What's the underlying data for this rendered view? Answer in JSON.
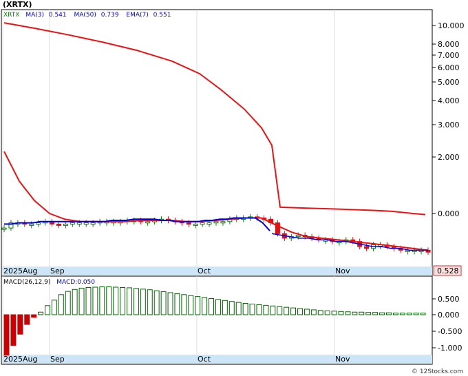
{
  "title": "(XRTX)",
  "legend": {
    "symbol": "XRTX",
    "ma3_label": "MA(3)",
    "ma3_value": "0.541",
    "ma50_label": "MA(50)",
    "ma50_value": "0.739",
    "ema7_label": "EMA(7)",
    "ema7_value": "0.551"
  },
  "macd_legend": {
    "params": "MACD(26,12,9)",
    "value_label": "MACD:0.050"
  },
  "price_badge": "0.528",
  "watermark": "© 12Stocks.com",
  "colors": {
    "ma3": "#0000dd",
    "ma50": "#ee1111",
    "up": "#008800",
    "down": "#dd1111",
    "hist_pos": "#006600",
    "hist_neg": "#cc0000",
    "axis_band": "#cce6f7"
  },
  "chart_data": [
    {
      "type": "line",
      "name": "price",
      "y_scale": "log",
      "y_ticks": [
        "10.000",
        "8.000",
        "7.000",
        "6.000",
        "5.000",
        "4.000",
        "3.000",
        "2.000",
        "0.000"
      ],
      "x_ticks": [
        "2025Aug",
        "Sep",
        "Oct",
        "Nov"
      ],
      "candles_close": [
        0.5,
        0.54,
        0.54,
        0.53,
        0.53,
        0.54,
        0.55,
        0.53,
        0.52,
        0.53,
        0.54,
        0.54,
        0.54,
        0.54,
        0.55,
        0.55,
        0.55,
        0.55,
        0.56,
        0.56,
        0.55,
        0.55,
        0.56,
        0.57,
        0.56,
        0.55,
        0.54,
        0.53,
        0.53,
        0.54,
        0.54,
        0.55,
        0.55,
        0.57,
        0.58,
        0.58,
        0.59,
        0.58,
        0.57,
        0.54,
        0.46,
        0.43,
        0.44,
        0.45,
        0.44,
        0.43,
        0.42,
        0.42,
        0.41,
        0.41,
        0.42,
        0.41,
        0.38,
        0.37,
        0.39,
        0.39,
        0.38,
        0.37,
        0.36,
        0.36,
        0.36,
        0.36,
        0.35
      ],
      "series": [
        {
          "name": "MA(3)",
          "values": [
            0.53,
            0.53,
            0.54,
            0.54,
            0.54,
            0.55,
            0.55,
            0.55,
            0.55,
            0.55,
            0.55,
            0.55,
            0.55,
            0.55,
            0.55,
            0.56,
            0.56,
            0.56,
            0.57,
            0.57,
            0.57,
            0.57,
            0.56,
            0.56,
            0.55,
            0.55,
            0.55,
            0.55,
            0.56,
            0.56,
            0.57,
            0.57,
            0.58,
            0.58,
            0.58,
            0.58,
            0.54,
            0.48,
            0.46,
            0.45,
            0.44,
            0.43,
            0.43,
            0.42,
            0.42,
            0.41,
            0.41,
            0.4,
            0.39,
            0.38,
            0.38,
            0.37,
            0.37,
            0.36,
            0.36,
            0.36
          ]
        },
        {
          "name": "MA(50)",
          "values": [
            10.4,
            9.6,
            8.7,
            7.8,
            6.9,
            5.9,
            4.9,
            3.9,
            2.9,
            2.2,
            1.7,
            0.68,
            0.67,
            0.66,
            0.65,
            0.64,
            0.62,
            0.61
          ]
        },
        {
          "name": "EMA(7)",
          "values": [
            1.55,
            1.0,
            0.75,
            0.62,
            0.57,
            0.55,
            0.55,
            0.55,
            0.55,
            0.56,
            0.56,
            0.56,
            0.55,
            0.55,
            0.56,
            0.57,
            0.58,
            0.58,
            0.52,
            0.47,
            0.44,
            0.43,
            0.42,
            0.41,
            0.4,
            0.39,
            0.38,
            0.37,
            0.36
          ]
        }
      ]
    },
    {
      "type": "bar",
      "name": "MACD histogram",
      "y_ticks": [
        "0.500",
        "0.000",
        "-0.500",
        "-1.000"
      ],
      "ylim": [
        -1.25,
        0.9
      ],
      "values": [
        -1.25,
        -0.95,
        -0.6,
        -0.3,
        -0.08,
        0.08,
        0.28,
        0.45,
        0.62,
        0.72,
        0.78,
        0.82,
        0.84,
        0.85,
        0.86,
        0.86,
        0.85,
        0.84,
        0.83,
        0.81,
        0.79,
        0.77,
        0.74,
        0.71,
        0.68,
        0.65,
        0.62,
        0.59,
        0.56,
        0.53,
        0.5,
        0.47,
        0.44,
        0.41,
        0.38,
        0.35,
        0.33,
        0.31,
        0.29,
        0.27,
        0.25,
        0.23,
        0.21,
        0.19,
        0.17,
        0.15,
        0.13,
        0.12,
        0.11,
        0.1,
        0.09,
        0.08,
        0.08,
        0.07,
        0.07,
        0.06,
        0.06,
        0.05,
        0.05,
        0.05,
        0.05,
        0.05
      ]
    }
  ]
}
